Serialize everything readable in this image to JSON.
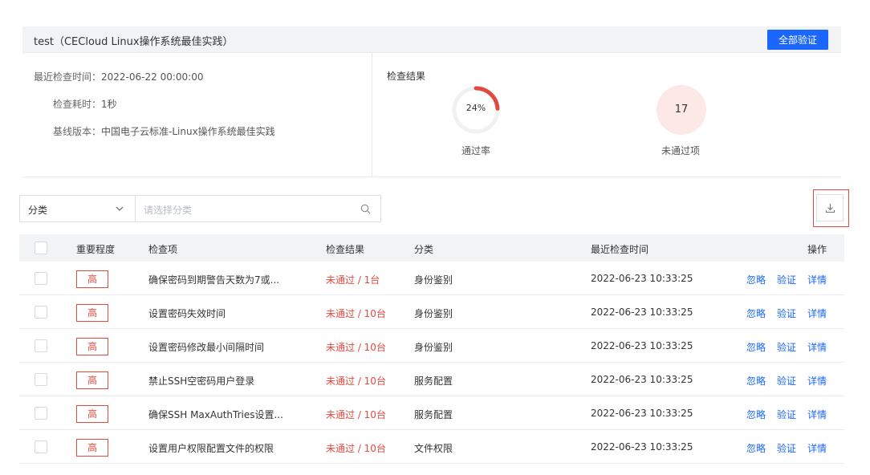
{
  "header": {
    "title": "test（CECloud Linux操作系统最佳实践）",
    "verify_all_label": "全部验证"
  },
  "info": {
    "last_check_label": "最近检查时间：",
    "last_check_value": "2022-06-22 00:00:00",
    "duration_label": "检查耗时：",
    "duration_value": "1秒",
    "baseline_label": "基线版本：",
    "baseline_value": "中国电子云标准-Linux操作系统最佳实践"
  },
  "result": {
    "title": "检查结果",
    "pass_rate_text": "24%",
    "pass_rate_value": 24,
    "pass_rate_label": "通过率",
    "failed_count": "17",
    "failed_label": "未通过项"
  },
  "filter": {
    "category_select_value": "分类",
    "category_placeholder": "请选择分类"
  },
  "table": {
    "headers": {
      "severity": "重要程度",
      "item": "检查项",
      "result": "检查结果",
      "category": "分类",
      "last_check": "最近检查时间",
      "actions": "操作"
    },
    "rows": [
      {
        "severity": "高",
        "item": "确保密码到期警告天数为7或...",
        "result": "未通过 / 1台",
        "category": "身份鉴别",
        "time": "2022-06-23 10:33:25",
        "ignore": "忽略",
        "verify": "验证",
        "detail": "详情"
      },
      {
        "severity": "高",
        "item": "设置密码失效时间",
        "result": "未通过 / 10台",
        "category": "身份鉴别",
        "time": "2022-06-23 10:33:25",
        "ignore": "忽略",
        "verify": "验证",
        "detail": "详情"
      },
      {
        "severity": "高",
        "item": "设置密码修改最小间隔时间",
        "result": "未通过 / 10台",
        "category": "身份鉴别",
        "time": "2022-06-23 10:33:25",
        "ignore": "忽略",
        "verify": "验证",
        "detail": "详情"
      },
      {
        "severity": "高",
        "item": "禁止SSH空密码用户登录",
        "result": "未通过 / 10台",
        "category": "服务配置",
        "time": "2022-06-23 10:33:25",
        "ignore": "忽略",
        "verify": "验证",
        "detail": "详情"
      },
      {
        "severity": "高",
        "item": "确保SSH MaxAuthTries设置...",
        "result": "未通过 / 10台",
        "category": "服务配置",
        "time": "2022-06-23 10:33:25",
        "ignore": "忽略",
        "verify": "验证",
        "detail": "详情"
      },
      {
        "severity": "高",
        "item": "设置用户权限配置文件的权限",
        "result": "未通过 / 10台",
        "category": "文件权限",
        "time": "2022-06-23 10:33:25",
        "ignore": "忽略",
        "verify": "验证",
        "detail": "详情"
      }
    ]
  },
  "colors": {
    "primary": "#1a66ff",
    "danger": "#e04a3f",
    "header_bg": "#f2f3f5",
    "failed_circle_bg": "#fde8e8"
  }
}
